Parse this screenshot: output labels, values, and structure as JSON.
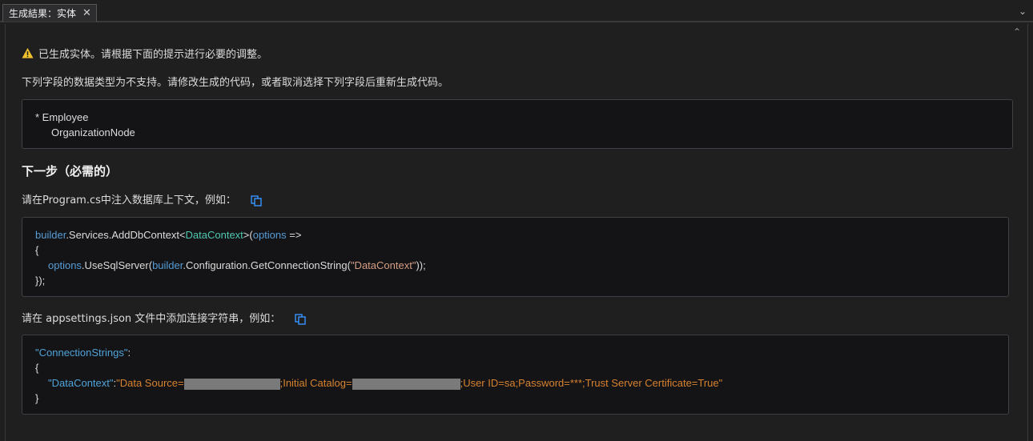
{
  "tab": {
    "title": "生成結果：实体",
    "close": "✕",
    "dropdown": "⌄"
  },
  "scroll_up": "⌃",
  "warning": "已生成实体。请根据下面的提示进行必要的调整。",
  "unsupported_message": "下列字段的数据类型为不支持。请修改生成的代码，或者取消选择下列字段后重新生成代码。",
  "fields_box": {
    "entity": "* Employee",
    "field": "OrganizationNode"
  },
  "next_step_heading": "下一步（必需的）",
  "program_instruction": "请在Program.cs中注入数据库上下文，例如：",
  "code1": {
    "l1_builder": "builder",
    "l1_services": ".Services.AddDbContext<",
    "l1_type": "DataContext",
    "l1_open": ">(",
    "l1_options": "options",
    "l1_arrow": " =>",
    "l2": "{",
    "l3_options": "options",
    "l3_use": ".UseSqlServer(",
    "l3_builder": "builder",
    "l3_config": ".Configuration.GetConnectionString(",
    "l3_string": "\"DataContext\"",
    "l3_close": "));",
    "l4": "});"
  },
  "appsettings_instruction": "请在 appsettings.json 文件中添加连接字符串，例如：",
  "code2": {
    "l1_key": "\"ConnectionStrings\"",
    "l1_colon": ":",
    "l2": "{",
    "l3_key": "\"DataContext\"",
    "l3_colon": ":",
    "l3_a": "\"Data Source=",
    "l3_b": ";Initial Catalog=",
    "l3_c": ";User ID=sa;Password=***;Trust Server Certificate=True\"",
    "l4": "}"
  },
  "colors": {
    "background": "#1f1f1f",
    "code_background": "#141416",
    "keyword_blue": "#569cd6",
    "type_green": "#4ec9b0",
    "json_key": "#4fa3d9",
    "json_value": "#d7822e",
    "warning_yellow": "#f2c12e"
  },
  "icons": {
    "warning": "warning-triangle-icon",
    "copy": "copy-icon",
    "close": "close-icon"
  }
}
